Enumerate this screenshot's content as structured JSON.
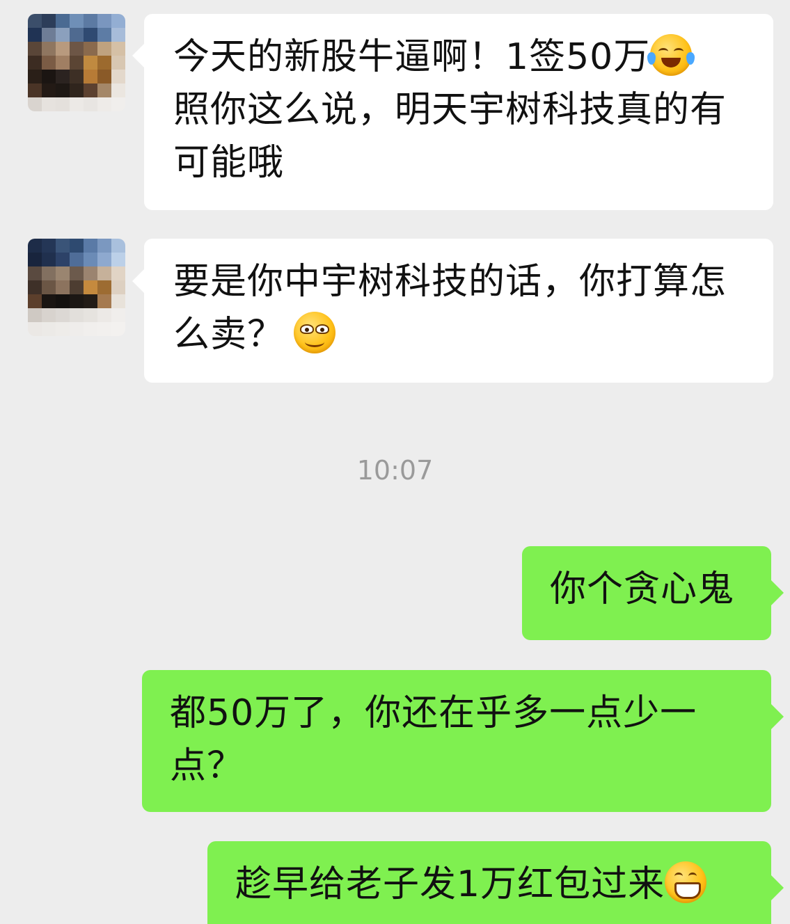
{
  "messages": [
    {
      "direction": "incoming",
      "text": "今天的新股牛逼啊！1签50万",
      "text_line2": "照你这么说，明天宇树科技真的有可能哦",
      "emoji": "laugh-cry-emoji"
    },
    {
      "direction": "incoming",
      "text": "要是你中宇树科技的话，你打算怎么卖？",
      "emoji": "smirk-emoji"
    },
    {
      "direction": "outgoing",
      "text": "你个贪心鬼"
    },
    {
      "direction": "outgoing",
      "text": "都50万了，你还在乎多一点少一点？"
    },
    {
      "direction": "outgoing",
      "text": "趁早给老子发1万红包过来",
      "emoji": "grin-emoji"
    }
  ],
  "timestamp": "10:07",
  "colors": {
    "background": "#ededed",
    "incoming_bubble": "#ffffff",
    "outgoing_bubble": "#7ff050",
    "timestamp_text": "#9a9a9a"
  }
}
